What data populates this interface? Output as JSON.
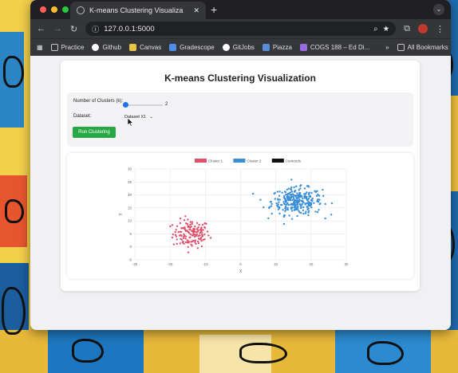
{
  "browser": {
    "tab_title": "K-means Clustering Visualiza",
    "new_tab": "+",
    "url": "127.0.0.1:5000",
    "bookmarks": [
      {
        "label": "Practice",
        "icon": "folder-icon",
        "color": "#c9c9cc"
      },
      {
        "label": "Github",
        "icon": "github-icon",
        "color": "#ffffff"
      },
      {
        "label": "Canvas",
        "icon": "canvas-icon",
        "color": "#e7c547"
      },
      {
        "label": "Gradescope",
        "icon": "gradescope-icon",
        "color": "#4d8ee6"
      },
      {
        "label": "GitJobs",
        "icon": "github-icon",
        "color": "#ffffff"
      },
      {
        "label": "Piazza",
        "icon": "piazza-icon",
        "color": "#5b8dd6"
      },
      {
        "label": "COGS 188 – Ed Di...",
        "icon": "ed-icon",
        "color": "#9a6be0"
      }
    ],
    "overflow": "»",
    "all_bookmarks": "All Bookmarks"
  },
  "page": {
    "title": "K-means Clustering Visualization",
    "k_label": "Number of Clusters (k):",
    "k_value": "2",
    "k_fraction": 0.0,
    "dataset_label": "Dataset:",
    "dataset_selected": "Dataset X1",
    "run_button": "Run Clustering"
  },
  "chart_data": {
    "type": "scatter",
    "xlabel": "X",
    "ylabel": "Y",
    "xlim": [
      -30,
      30
    ],
    "ylim": [
      -5,
      30
    ],
    "xticks": [
      -30,
      -20,
      -10,
      0,
      10,
      20,
      30
    ],
    "yticks": [
      -5,
      0,
      5,
      10,
      15,
      20,
      25,
      30
    ],
    "grid": true,
    "legend_position": "top-center",
    "series": [
      {
        "name": "Cluster 1",
        "color": "#e0526c",
        "center": [
          -14,
          5
        ],
        "spread": [
          4,
          3.4
        ],
        "count": 150
      },
      {
        "name": "Cluster 2",
        "color": "#3a8fd6",
        "center": [
          16,
          17.5
        ],
        "spread": [
          5.5,
          3.2
        ],
        "count": 300
      },
      {
        "name": "Centroids",
        "color": "#111111",
        "points": []
      }
    ]
  },
  "colors": {
    "accent": "#1a73e8",
    "run_button": "#28a745"
  }
}
